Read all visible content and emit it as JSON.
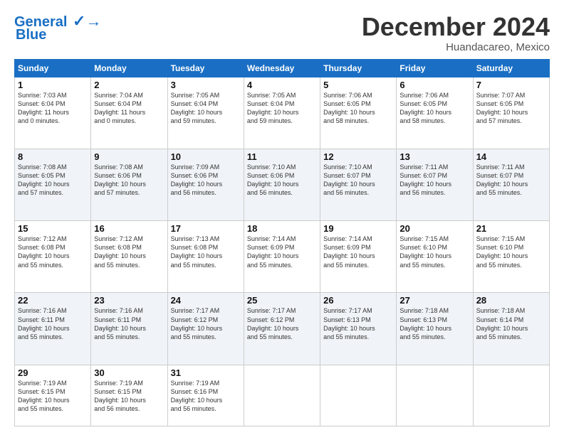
{
  "header": {
    "logo_line1": "General",
    "logo_line2": "Blue",
    "month_title": "December 2024",
    "location": "Huandacareo, Mexico"
  },
  "weekdays": [
    "Sunday",
    "Monday",
    "Tuesday",
    "Wednesday",
    "Thursday",
    "Friday",
    "Saturday"
  ],
  "weeks": [
    [
      {
        "day": "1",
        "info": "Sunrise: 7:03 AM\nSunset: 6:04 PM\nDaylight: 11 hours\nand 0 minutes."
      },
      {
        "day": "2",
        "info": "Sunrise: 7:04 AM\nSunset: 6:04 PM\nDaylight: 11 hours\nand 0 minutes."
      },
      {
        "day": "3",
        "info": "Sunrise: 7:05 AM\nSunset: 6:04 PM\nDaylight: 10 hours\nand 59 minutes."
      },
      {
        "day": "4",
        "info": "Sunrise: 7:05 AM\nSunset: 6:04 PM\nDaylight: 10 hours\nand 59 minutes."
      },
      {
        "day": "5",
        "info": "Sunrise: 7:06 AM\nSunset: 6:05 PM\nDaylight: 10 hours\nand 58 minutes."
      },
      {
        "day": "6",
        "info": "Sunrise: 7:06 AM\nSunset: 6:05 PM\nDaylight: 10 hours\nand 58 minutes."
      },
      {
        "day": "7",
        "info": "Sunrise: 7:07 AM\nSunset: 6:05 PM\nDaylight: 10 hours\nand 57 minutes."
      }
    ],
    [
      {
        "day": "8",
        "info": "Sunrise: 7:08 AM\nSunset: 6:05 PM\nDaylight: 10 hours\nand 57 minutes."
      },
      {
        "day": "9",
        "info": "Sunrise: 7:08 AM\nSunset: 6:06 PM\nDaylight: 10 hours\nand 57 minutes."
      },
      {
        "day": "10",
        "info": "Sunrise: 7:09 AM\nSunset: 6:06 PM\nDaylight: 10 hours\nand 56 minutes."
      },
      {
        "day": "11",
        "info": "Sunrise: 7:10 AM\nSunset: 6:06 PM\nDaylight: 10 hours\nand 56 minutes."
      },
      {
        "day": "12",
        "info": "Sunrise: 7:10 AM\nSunset: 6:07 PM\nDaylight: 10 hours\nand 56 minutes."
      },
      {
        "day": "13",
        "info": "Sunrise: 7:11 AM\nSunset: 6:07 PM\nDaylight: 10 hours\nand 56 minutes."
      },
      {
        "day": "14",
        "info": "Sunrise: 7:11 AM\nSunset: 6:07 PM\nDaylight: 10 hours\nand 55 minutes."
      }
    ],
    [
      {
        "day": "15",
        "info": "Sunrise: 7:12 AM\nSunset: 6:08 PM\nDaylight: 10 hours\nand 55 minutes."
      },
      {
        "day": "16",
        "info": "Sunrise: 7:12 AM\nSunset: 6:08 PM\nDaylight: 10 hours\nand 55 minutes."
      },
      {
        "day": "17",
        "info": "Sunrise: 7:13 AM\nSunset: 6:08 PM\nDaylight: 10 hours\nand 55 minutes."
      },
      {
        "day": "18",
        "info": "Sunrise: 7:14 AM\nSunset: 6:09 PM\nDaylight: 10 hours\nand 55 minutes."
      },
      {
        "day": "19",
        "info": "Sunrise: 7:14 AM\nSunset: 6:09 PM\nDaylight: 10 hours\nand 55 minutes."
      },
      {
        "day": "20",
        "info": "Sunrise: 7:15 AM\nSunset: 6:10 PM\nDaylight: 10 hours\nand 55 minutes."
      },
      {
        "day": "21",
        "info": "Sunrise: 7:15 AM\nSunset: 6:10 PM\nDaylight: 10 hours\nand 55 minutes."
      }
    ],
    [
      {
        "day": "22",
        "info": "Sunrise: 7:16 AM\nSunset: 6:11 PM\nDaylight: 10 hours\nand 55 minutes."
      },
      {
        "day": "23",
        "info": "Sunrise: 7:16 AM\nSunset: 6:11 PM\nDaylight: 10 hours\nand 55 minutes."
      },
      {
        "day": "24",
        "info": "Sunrise: 7:17 AM\nSunset: 6:12 PM\nDaylight: 10 hours\nand 55 minutes."
      },
      {
        "day": "25",
        "info": "Sunrise: 7:17 AM\nSunset: 6:12 PM\nDaylight: 10 hours\nand 55 minutes."
      },
      {
        "day": "26",
        "info": "Sunrise: 7:17 AM\nSunset: 6:13 PM\nDaylight: 10 hours\nand 55 minutes."
      },
      {
        "day": "27",
        "info": "Sunrise: 7:18 AM\nSunset: 6:13 PM\nDaylight: 10 hours\nand 55 minutes."
      },
      {
        "day": "28",
        "info": "Sunrise: 7:18 AM\nSunset: 6:14 PM\nDaylight: 10 hours\nand 55 minutes."
      }
    ],
    [
      {
        "day": "29",
        "info": "Sunrise: 7:19 AM\nSunset: 6:15 PM\nDaylight: 10 hours\nand 55 minutes."
      },
      {
        "day": "30",
        "info": "Sunrise: 7:19 AM\nSunset: 6:15 PM\nDaylight: 10 hours\nand 56 minutes."
      },
      {
        "day": "31",
        "info": "Sunrise: 7:19 AM\nSunset: 6:16 PM\nDaylight: 10 hours\nand 56 minutes."
      },
      null,
      null,
      null,
      null
    ]
  ]
}
